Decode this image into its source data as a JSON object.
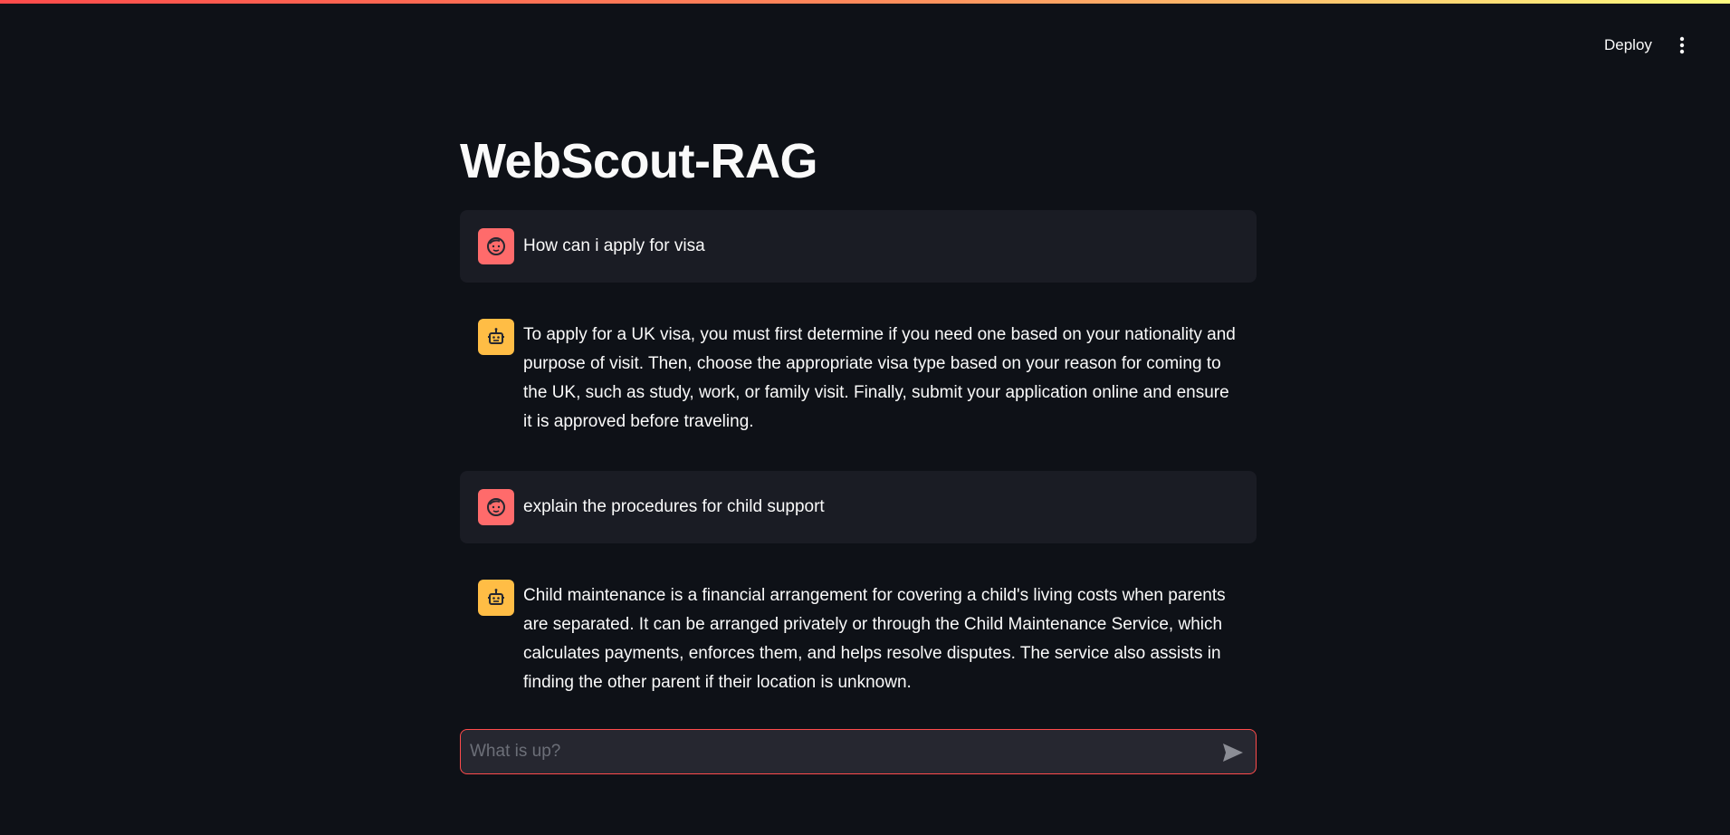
{
  "header": {
    "deploy_label": "Deploy",
    "menu_icon": "kebab-menu-icon"
  },
  "page": {
    "title": "WebScout-RAG"
  },
  "messages": [
    {
      "role": "user",
      "avatar_icon": "user-face-icon",
      "text": "How can i apply for visa"
    },
    {
      "role": "assistant",
      "avatar_icon": "robot-icon",
      "text": "To apply for a UK visa, you must first determine if you need one based on your nationality and purpose of visit. Then, choose the appropriate visa type based on your reason for coming to the UK, such as study, work, or family visit. Finally, submit your application online and ensure it is approved before traveling."
    },
    {
      "role": "user",
      "avatar_icon": "user-face-icon",
      "text": "explain the procedures for child support"
    },
    {
      "role": "assistant",
      "avatar_icon": "robot-icon",
      "text": "Child maintenance is a financial arrangement for covering a child's living costs when parents are separated. It can be arranged privately or through the Child Maintenance Service, which calculates payments, enforces them, and helps resolve disputes. The service also assists in finding the other parent if their location is unknown."
    }
  ],
  "chat_input": {
    "placeholder": "What is up?",
    "value": "",
    "send_icon": "send-icon"
  },
  "colors": {
    "background": "#0e1117",
    "user_message_bg": "#1a1c24",
    "user_avatar": "#ff6b6b",
    "assistant_avatar": "#ffbd45",
    "accent": "#ff4b4b"
  }
}
